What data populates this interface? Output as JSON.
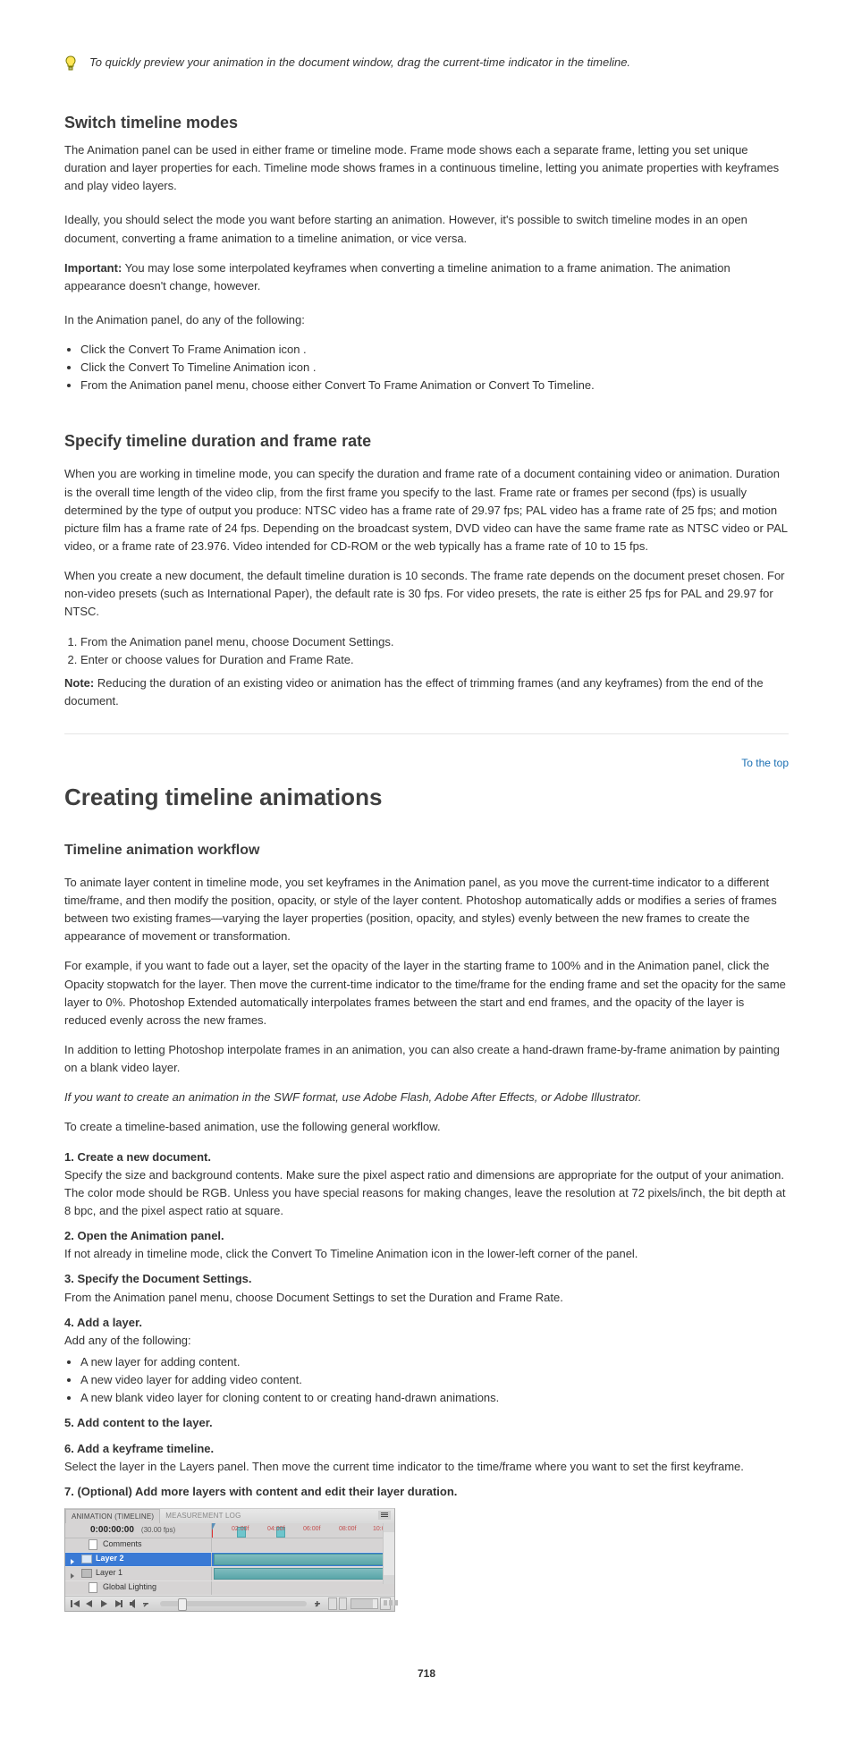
{
  "tip": "To quickly preview your animation in the document window, drag the current-time indicator in the timeline.",
  "switch": {
    "heading": "Switch timeline modes",
    "lead": "The Animation panel can be used in either frame or timeline mode. Frame mode shows each a separate frame, letting you set unique duration and layer properties for each. Timeline mode shows frames in a continuous timeline, letting you animate properties with keyframes and play video layers.",
    "lead2": "Ideally, you should select the mode you want before starting an animation. However, it's possible to switch timeline modes in an open document, converting a frame animation to a timeline animation, or vice versa.",
    "important_label": "Important:",
    "important": "You may lose some interpolated keyframes when converting a timeline animation to a frame animation. The animation appearance doesn't change, however.",
    "bullet_lead": "In the Animation panel, do any of the following:",
    "bullets": [
      "Click the Convert To Frame Animation icon .",
      "Click the Convert To Timeline Animation icon .",
      "From the Animation panel menu, choose either Convert To Frame Animation or Convert To Timeline."
    ]
  },
  "duration": {
    "heading": "Specify timeline duration and frame rate",
    "body": "When you are working in timeline mode, you can specify the duration and frame rate of a document containing video or animation. Duration is the overall time length of the video clip, from the first frame you specify to the last. Frame rate or frames per second (fps) is usually determined by the type of output you produce: NTSC video has a frame rate of 29.97 fps; PAL video has a frame rate of 25 fps; and motion picture film has a frame rate of 24 fps. Depending on the broadcast system, DVD video can have the same frame rate as NTSC video or PAL video, or a frame rate of 23.976. Video intended for CD-ROM or the web typically has a frame rate of 10 to 15 fps.",
    "body2": "When you create a new document, the default timeline duration is 10 seconds. The frame rate depends on the document preset chosen. For non-video presets (such as International Paper), the default rate is 30 fps. For video presets, the rate is either 25 fps for PAL and 29.97 for NTSC.",
    "step1": "From the Animation panel menu, choose Document Settings.",
    "step2": "Enter or choose values for Duration and Frame Rate.",
    "note_label": "Note:",
    "note": "Reducing the duration of an existing video or animation has the effect of trimming frames (and any keyframes) from the end of the document."
  },
  "toplink": "To the top",
  "section_title": "Creating timeline animations",
  "intro": {
    "heading": "Timeline animation workflow",
    "p1": "To animate layer content in timeline mode, you set keyframes in the Animation panel, as you move the current-time indicator to a different time/frame, and then modify the position, opacity, or style of the layer content. Photoshop automatically adds or modifies a series of frames between two existing frames—varying the layer properties (position, opacity, and styles) evenly between the new frames to create the appearance of movement or transformation.",
    "p2": "For example, if you want to fade out a layer, set the opacity of the layer in the starting frame to 100% and in the Animation panel, click the Opacity stopwatch for the layer. Then move the current-time indicator to the time/frame for the ending frame and set the opacity for the same layer to 0%. Photoshop Extended automatically interpolates frames between the start and end frames, and the opacity of the layer is reduced evenly across the new frames.",
    "p3": "In addition to letting Photoshop interpolate frames in an animation, you can also create a hand-drawn frame-by-frame animation by painting on a blank video layer.",
    "tip": "If you want to create an animation in the SWF format, use Adobe Flash, Adobe After Effects, or Adobe Illustrator."
  },
  "workflow": {
    "p": "To create a timeline-based animation, use the following general workflow.",
    "s1t": "1. Create a new document.",
    "s1p": "Specify the size and background contents. Make sure the pixel aspect ratio and dimensions are appropriate for the output of your animation. The color mode should be RGB. Unless you have special reasons for making changes, leave the resolution at 72 pixels/inch, the bit depth at 8 bpc, and the pixel aspect ratio at square.",
    "s2t": "2. Open the Animation panel.",
    "s2p": "If not already in timeline mode, click the Convert To Timeline Animation icon in the lower-left corner of the panel.",
    "s3t": "3. Specify the Document Settings.",
    "s3p": "From the Animation panel menu, choose Document Settings to set the Duration and Frame Rate.",
    "s4t": "4. Add a layer.",
    "s4p": "Add any of the following:",
    "s4opts": [
      "A new layer for adding content.",
      "A new video layer for adding video content.",
      "A new blank video layer for cloning content to or creating hand-drawn animations."
    ],
    "s5t": "5. Add content to the layer.",
    "s6t": "6. Add a keyframe timeline.",
    "s6p": "Select the layer in the Layers panel. Then move the current time indicator to the time/frame where you want to set the first keyframe.",
    "s7t": "7. (Optional) Add more layers with content and edit their layer duration."
  },
  "panel": {
    "tab_active": "ANIMATION (TIMELINE)",
    "tab_inactive": "MEASUREMENT LOG",
    "timecode": "0:00:00:00",
    "fps": "(30.00 fps)",
    "ticks": [
      "02:00f",
      "04:00f",
      "06:00f",
      "08:00f",
      "10:0"
    ],
    "tracks": [
      {
        "name": "Comments",
        "type": "comments"
      },
      {
        "name": "Layer 2",
        "type": "layer",
        "selected": true
      },
      {
        "name": "Layer 1",
        "type": "layer",
        "selected": false
      },
      {
        "name": "Global Lighting",
        "type": "global"
      }
    ]
  },
  "page": "718"
}
